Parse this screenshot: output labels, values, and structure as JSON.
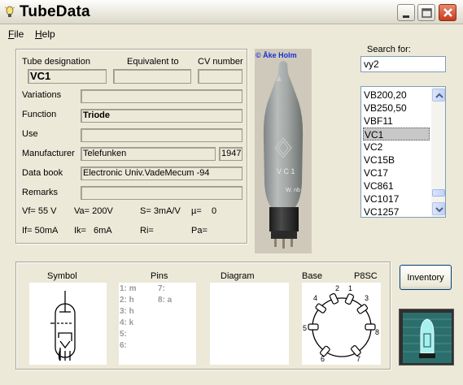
{
  "window": {
    "title": "TubeData"
  },
  "menu": [
    {
      "label": "File"
    },
    {
      "label": "Help"
    }
  ],
  "details": {
    "tube_designation_label": "Tube designation",
    "equivalent_label": "Equivalent to",
    "cv_label": "CV number",
    "tube_designation": "VC1",
    "equivalent": "",
    "cv_number": "",
    "variations_label": "Variations",
    "variations": "",
    "function_label": "Function",
    "function": "Triode",
    "use_label": "Use",
    "use": "",
    "manufacturer_label": "Manufacturer",
    "manufacturer": "Telefunken",
    "year": "1947",
    "databook_label": "Data book",
    "databook": "Electronic Univ.VadeMecum -94",
    "remarks_label": "Remarks",
    "remarks": "",
    "vf": "Vf= 55 V",
    "va": "Va= 200V",
    "s": "S= 3mA/V",
    "mu": "µ=",
    "mu_value": "0",
    "if": "If= 50mA",
    "ik": "Ik=",
    "ik_value": "6mA",
    "ri": "Ri=",
    "pa": "Pa="
  },
  "photo": {
    "credit": "© Åke Holm",
    "tube_text": "V C 1",
    "tube_text2": "W. nb"
  },
  "search": {
    "label": "Search for:",
    "value": "vy2",
    "results": [
      "VB200,20",
      "VB250,50",
      "VBF11",
      "VC1",
      "VC2",
      "VC15B",
      "VC17",
      "VC861",
      "VC1017",
      "VC1257"
    ],
    "selected": "VC1"
  },
  "bottom": {
    "symbol_label": "Symbol",
    "pins_label": "Pins",
    "diagram_label": "Diagram",
    "base_label": "Base",
    "base_type": "P8SC",
    "pins": [
      "1: m",
      "2: h",
      "3: h",
      "4: k",
      "5:",
      "6:",
      "7:",
      "8: a"
    ],
    "base_numbers": [
      "1",
      "2",
      "3",
      "4",
      "5",
      "6",
      "7",
      "8"
    ]
  },
  "inventory_label": "Inventory"
}
